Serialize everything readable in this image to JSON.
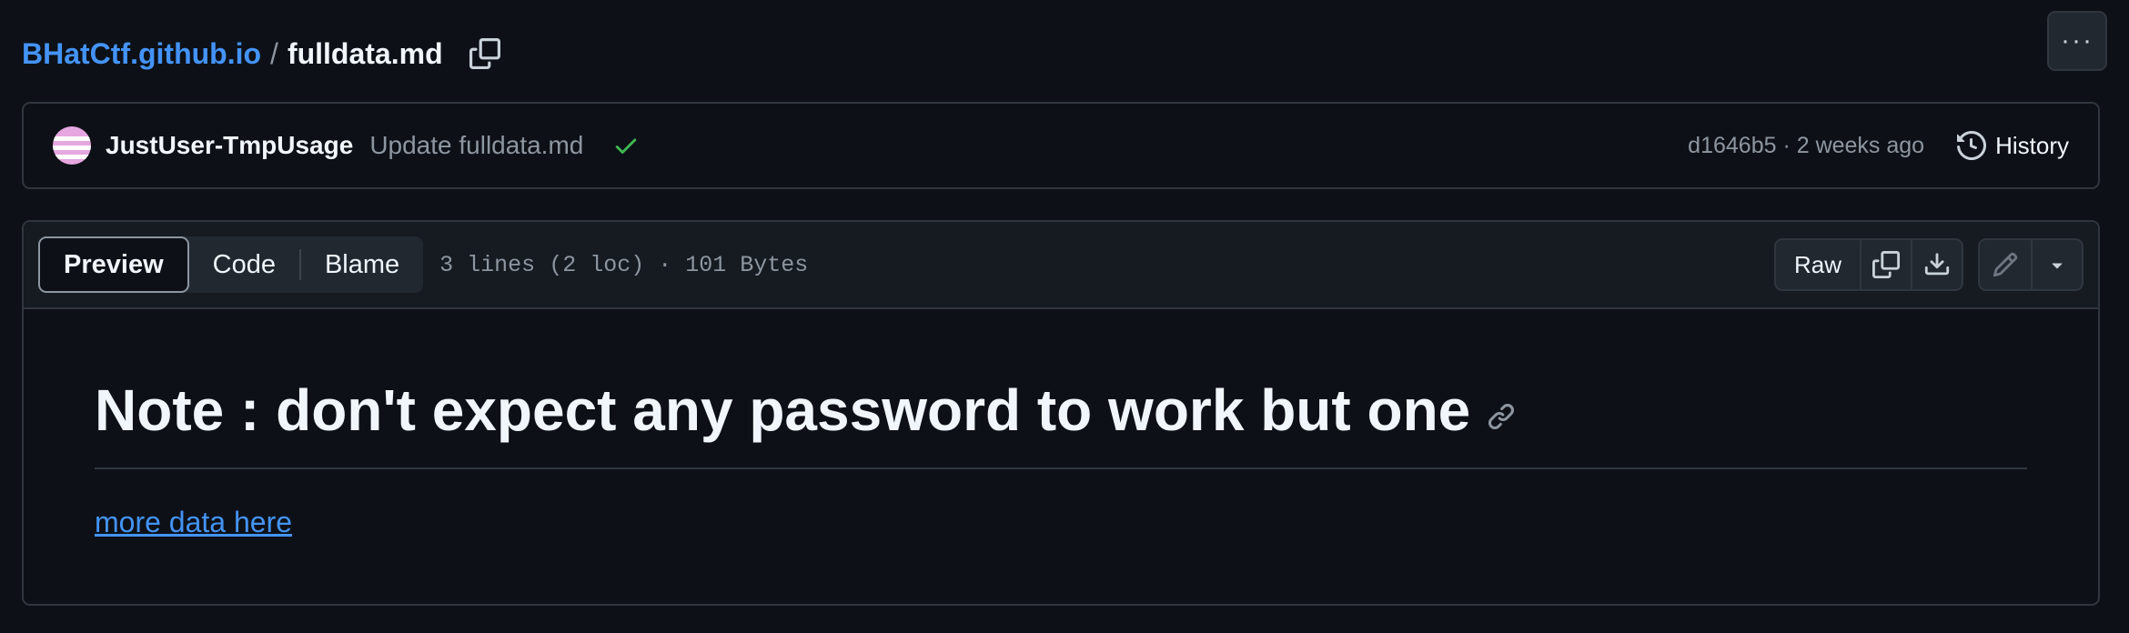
{
  "breadcrumb": {
    "repo": "BHatCtf.github.io",
    "separator": "/",
    "file": "fulldata.md"
  },
  "more_menu": {
    "label": "···"
  },
  "commit": {
    "author": "JustUser-TmpUsage",
    "message": "Update fulldata.md",
    "status": "success",
    "meta": "d1646b5 · 2 weeks ago",
    "history_label": "History"
  },
  "file_header": {
    "tabs": [
      {
        "label": "Preview",
        "active": true
      },
      {
        "label": "Code",
        "active": false
      },
      {
        "label": "Blame",
        "active": false
      }
    ],
    "info": "3 lines (2 loc) · 101 Bytes",
    "raw_label": "Raw"
  },
  "content": {
    "heading": "Note : don't expect any password to work but one",
    "link_text": "more data here"
  },
  "colors": {
    "background": "#0d1117",
    "link": "#4493f8",
    "border": "#30363d",
    "success": "#3fb950",
    "muted": "#8d96a0"
  },
  "icons": [
    "copy-icon",
    "kebab-icon",
    "check-icon",
    "history-icon",
    "download-icon",
    "pencil-icon",
    "triangle-down-icon",
    "link-icon"
  ]
}
